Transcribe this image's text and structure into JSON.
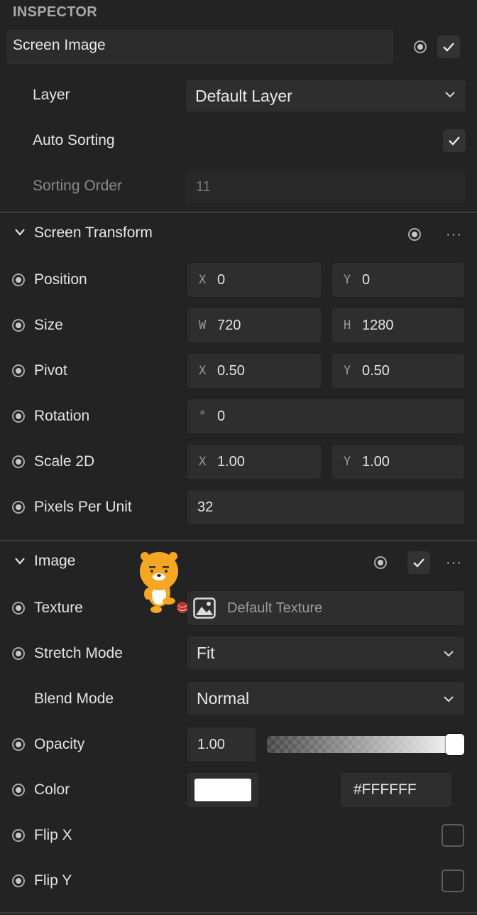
{
  "panel": {
    "title": "INSPECTOR"
  },
  "object": {
    "name": "Screen Image",
    "active": true
  },
  "rows": {
    "layer": {
      "label": "Layer",
      "value": "Default Layer"
    },
    "auto_sorting": {
      "label": "Auto Sorting",
      "checked": true
    },
    "sorting_order": {
      "label": "Sorting Order",
      "value": "11"
    }
  },
  "screen_transform": {
    "title": "Screen Transform",
    "more": "···",
    "position": {
      "label": "Position",
      "x_axis": "X",
      "x": "0",
      "y_axis": "Y",
      "y": "0"
    },
    "size": {
      "label": "Size",
      "w_axis": "W",
      "w": "720",
      "h_axis": "H",
      "h": "1280"
    },
    "pivot": {
      "label": "Pivot",
      "x_axis": "X",
      "x": "0.50",
      "y_axis": "Y",
      "y": "0.50"
    },
    "rotation": {
      "label": "Rotation",
      "axis": "°",
      "value": "0"
    },
    "scale": {
      "label": "Scale 2D",
      "x_axis": "X",
      "x": "1.00",
      "y_axis": "Y",
      "y": "1.00"
    },
    "ppu": {
      "label": "Pixels Per Unit",
      "value": "32"
    }
  },
  "image": {
    "title": "Image",
    "more": "···",
    "enabled": true,
    "texture": {
      "label": "Texture",
      "value": "Default Texture"
    },
    "stretch_mode": {
      "label": "Stretch Mode",
      "value": "Fit"
    },
    "blend_mode": {
      "label": "Blend Mode",
      "value": "Normal"
    },
    "opacity": {
      "label": "Opacity",
      "value": "1.00",
      "fraction": 1.0
    },
    "color": {
      "label": "Color",
      "hex": "#FFFFFF"
    },
    "flip_x": {
      "label": "Flip X",
      "checked": false
    },
    "flip_y": {
      "label": "Flip Y",
      "checked": false
    }
  },
  "icons": [
    "radio-dot-icon",
    "check-icon",
    "chevron-down-icon",
    "more-icon",
    "image-icon",
    "mascot-sticker-icon"
  ],
  "colors": {
    "background": "#232323",
    "field": "#2e2e2e",
    "text": "#e3e3e3",
    "muted": "#8a8a8a",
    "swatch": "#FFFFFF"
  }
}
